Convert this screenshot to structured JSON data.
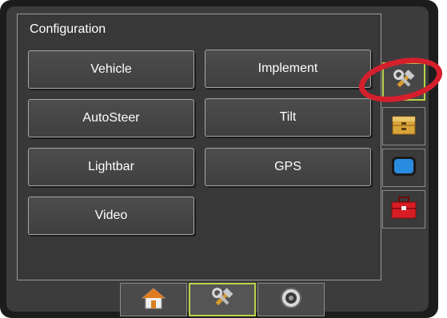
{
  "panel": {
    "title": "Configuration"
  },
  "menu": [
    {
      "label": "Vehicle"
    },
    {
      "label": "Implement"
    },
    {
      "label": "AutoSteer"
    },
    {
      "label": "Tilt"
    },
    {
      "label": "Lightbar"
    },
    {
      "label": "GPS"
    },
    {
      "label": "Video"
    }
  ],
  "side_tabs": [
    {
      "icon": "tools-icon",
      "selected": true
    },
    {
      "icon": "toolbox-drawer-icon",
      "selected": false
    },
    {
      "icon": "display-screen-icon",
      "selected": false
    },
    {
      "icon": "red-toolbox-icon",
      "selected": false
    }
  ],
  "bottom_tabs": [
    {
      "icon": "home-icon",
      "selected": false
    },
    {
      "icon": "tools-icon",
      "selected": true
    },
    {
      "icon": "gauge-icon",
      "selected": false
    }
  ],
  "colors": {
    "accent_selected_border": "#b8d44a",
    "highlight_ring": "#d4202c",
    "screen_background": "#3c3c3c"
  }
}
